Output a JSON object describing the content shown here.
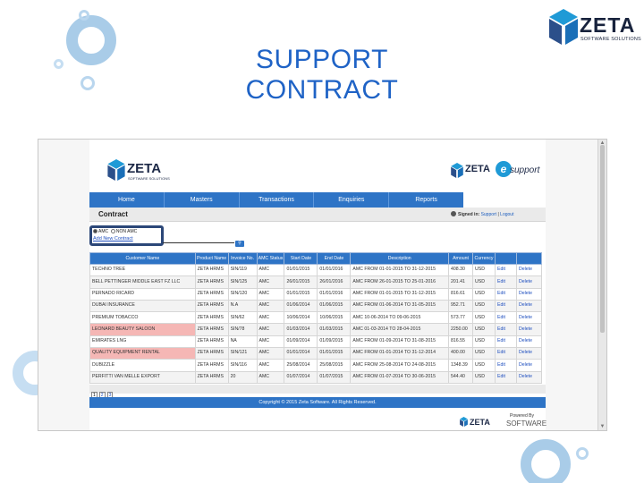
{
  "slide": {
    "title": "SUPPORT CONTRACT",
    "brand_word": "ZETA",
    "brand_tagline": "SOFTWARE SOLUTIONS"
  },
  "app": {
    "logo_word": "ZETA",
    "logo_tagline": "SOFTWARE SOLUTIONS",
    "esupport_word": "ZETA",
    "esupport_e": "e",
    "esupport_suffix": "support",
    "nav": [
      "Home",
      "Masters",
      "Transactions",
      "Enquiries",
      "Reports"
    ],
    "page_title": "Contract",
    "signed_in_label": "Signed in:",
    "support_link": "Support",
    "separator": "|",
    "logout_link": "Logout",
    "filter": {
      "amc_label": "AMC",
      "non_amc_label": "NON AMC",
      "selected": "AMC",
      "add_link": "Add New Contract"
    },
    "table": {
      "headers": [
        "Customer Name",
        "Product Name",
        "Invoice No.",
        "AMC Status",
        "Start Date",
        "End Date",
        "Description",
        "Amount",
        "Currency",
        "",
        ""
      ],
      "rows": [
        {
          "customer": "TECHNO TREE",
          "product": "ZETA HRMS",
          "invoice": "SIN/119",
          "status": "AMC",
          "start": "01/01/2015",
          "end": "01/01/2016",
          "description": "AMC FROM 01-01-2015 TO 31-12-2015",
          "amount": "408.30",
          "currency": "USD",
          "edit": "Edit",
          "delete": "Delete",
          "highlight": false
        },
        {
          "customer": "BELL PETTINGER MIDDLE EAST FZ LLC",
          "product": "ZETA HRMS",
          "invoice": "SIN/125",
          "status": "AMC",
          "start": "26/01/2015",
          "end": "26/01/2016",
          "description": "AMC FROM 26-01-2015 TO 25-01-2016",
          "amount": "201.41",
          "currency": "USD",
          "edit": "Edit",
          "delete": "Delete",
          "highlight": false
        },
        {
          "customer": "PERNADO RICARD",
          "product": "ZETA HRMS",
          "invoice": "SIN/120",
          "status": "AMC",
          "start": "01/01/2015",
          "end": "01/01/2016",
          "description": "AMC FROM 01-01-2015 TO 31-12-2015",
          "amount": "816.61",
          "currency": "USD",
          "edit": "Edit",
          "delete": "Delete",
          "highlight": false
        },
        {
          "customer": "DUBAI INSURANCE",
          "product": "ZETA HRMS",
          "invoice": "N.A",
          "status": "AMC",
          "start": "01/06/2014",
          "end": "01/06/2015",
          "description": "AMC FROM 01-06-2014 TO 31-05-2015",
          "amount": "952.71",
          "currency": "USD",
          "edit": "Edit",
          "delete": "Delete",
          "highlight": false
        },
        {
          "customer": "PREMIUM TOBACCO",
          "product": "ZETA HRMS",
          "invoice": "SIN/62",
          "status": "AMC",
          "start": "10/06/2014",
          "end": "10/06/2015",
          "description": "AMC 10-06-2014 TO 09-06-2015",
          "amount": "573.77",
          "currency": "USD",
          "edit": "Edit",
          "delete": "Delete",
          "highlight": false
        },
        {
          "customer": "LEONARD BEAUTY SALOON",
          "product": "ZETA HRMS",
          "invoice": "SIN/78",
          "status": "AMC",
          "start": "01/03/2014",
          "end": "01/03/2015",
          "description": "AMC 01-03-2014 TO 28-04-2015",
          "amount": "2250.00",
          "currency": "USD",
          "edit": "Edit",
          "delete": "Delete",
          "highlight": true
        },
        {
          "customer": "EMIRATES LNG",
          "product": "ZETA HRMS",
          "invoice": "NA",
          "status": "AMC",
          "start": "01/09/2014",
          "end": "01/09/2015",
          "description": "AMC FROM 01-09-2014 TO 31-08-2015",
          "amount": "816.55",
          "currency": "USD",
          "edit": "Edit",
          "delete": "Delete",
          "highlight": false
        },
        {
          "customer": "QUALITY EQUIPMENT RENTAL",
          "product": "ZETA HRMS",
          "invoice": "SIN/121",
          "status": "AMC",
          "start": "01/01/2014",
          "end": "01/01/2015",
          "description": "AMC FROM 01-01-2014 TO 31-12-2014",
          "amount": "400.00",
          "currency": "USD",
          "edit": "Edit",
          "delete": "Delete",
          "highlight": true
        },
        {
          "customer": "DUBIZZLE",
          "product": "ZETA HRMS",
          "invoice": "SIN/116",
          "status": "AMC",
          "start": "25/08/2014",
          "end": "25/08/2015",
          "description": "AMC FROM 25-08-2014 TO 24-08-2015",
          "amount": "1348.39",
          "currency": "USD",
          "edit": "Edit",
          "delete": "Delete",
          "highlight": false
        },
        {
          "customer": "PERFITTI VAN MELLE EXPORT",
          "product": "ZETA HRMS",
          "invoice": "20",
          "status": "AMC",
          "start": "01/07/2014",
          "end": "01/07/2015",
          "description": "AMC FROM 01-07-2014 TO 30-06-2015",
          "amount": "544.40",
          "currency": "USD",
          "edit": "Edit",
          "delete": "Delete",
          "highlight": false
        }
      ]
    },
    "pager": [
      "1",
      "2",
      "3"
    ],
    "footer": "Copyright © 2015 Zeta Software. All Rights Reserved.",
    "powered_by": "Powered By",
    "powered_word": "ZETA",
    "powered_software": "SOFTWARE"
  },
  "colors": {
    "title_blue": "#1f63c6",
    "nav_blue": "#2e74c6",
    "highlight_pink": "#f5b7b5",
    "ring_blue": "#4a90c8"
  }
}
